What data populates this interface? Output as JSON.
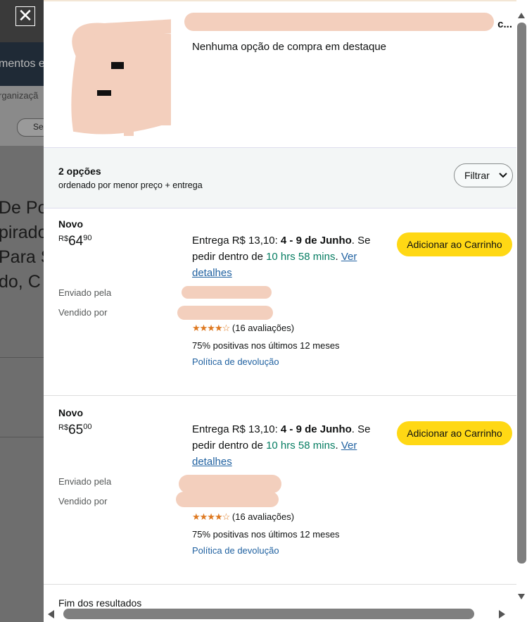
{
  "backdrop": {
    "nav_text": "mentos e",
    "sub_text": "rganizaçã",
    "pill_text": "Sei",
    "title_lines": "De Po\npirado\nPara S\ndo, C"
  },
  "close_glyph": "✕",
  "product": {
    "title": "c...",
    "no_featured": "Nenhuma opção de compra em destaque"
  },
  "summary": {
    "count": "2 opções",
    "sort": "ordenado por menor preço + entrega",
    "filter_label": "Filtrar"
  },
  "offers": [
    {
      "condition": "Novo",
      "currency": "R$",
      "price_whole": "64",
      "price_fraction": "90",
      "delivery_prefix": "Entrega R$ 13,10: ",
      "delivery_dates": "4 - 9 de Junho",
      "delivery_mid": ". Se pedir dentro de ",
      "countdown": "10 hrs 58 mins",
      "details_link": "Ver detalhes",
      "add_to_cart": "Adicionar ao Carrinho",
      "shipped_by_label": "Enviado pela",
      "sold_by_label": "Vendido por",
      "stars": "★★★★☆",
      "ratings": "(16 avaliações)",
      "rating_value": 4,
      "positive": "75% positivas nos últimos 12 meses",
      "return_policy": "Política de devolução"
    },
    {
      "condition": "Novo",
      "currency": "R$",
      "price_whole": "65",
      "price_fraction": "00",
      "delivery_prefix": "Entrega R$ 13,10: ",
      "delivery_dates": "4 - 9 de Junho",
      "delivery_mid": ". Se pedir dentro de ",
      "countdown": "10 hrs 58 mins",
      "details_link": "Ver detalhes",
      "add_to_cart": "Adicionar ao Carrinho",
      "shipped_by_label": "Enviado pela",
      "sold_by_label": "Vendido por",
      "stars": "★★★★☆",
      "ratings": "(16 avaliações)",
      "rating_value": 4,
      "positive": "75% positivas nos últimos 12 meses",
      "return_policy": "Política de devolução"
    }
  ],
  "end_of_results": "Fim dos resultados",
  "colors": {
    "add_button": "#ffd814",
    "countdown_green": "#067d62",
    "link_blue": "#2162a1",
    "star_orange": "#de7921",
    "redaction": "#f3cfbd"
  }
}
